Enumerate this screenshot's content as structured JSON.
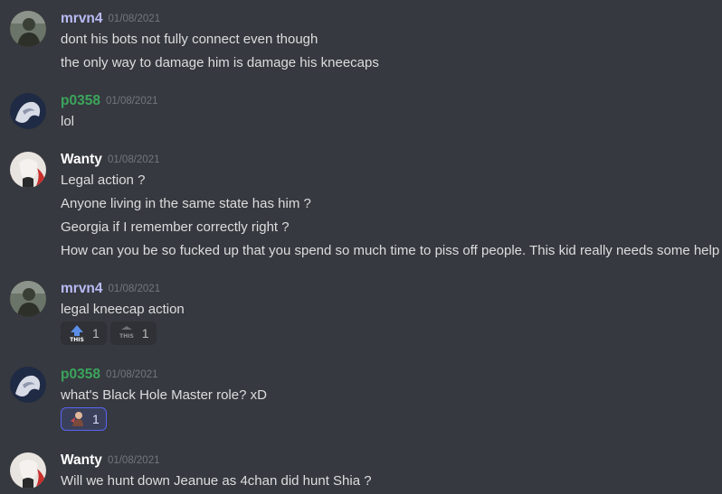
{
  "colors": {
    "background": "#36393f",
    "mrvn4": "#b9bbf5",
    "p0358": "#3ba55c",
    "wanty": "#ffffff",
    "timestamp": "#72767d",
    "text": "#dcddde",
    "reaction_me_border": "#5865f2"
  },
  "messages": [
    {
      "author": "mrvn4",
      "timestamp": "01/08/2021",
      "lines": [
        "dont his bots not fully connect even though",
        "the only way to damage him is damage his kneecaps"
      ]
    },
    {
      "author": "p0358",
      "timestamp": "01/08/2021",
      "lines": [
        "lol"
      ]
    },
    {
      "author": "Wanty",
      "timestamp": "01/08/2021",
      "lines": [
        "Legal action ?",
        "Anyone living in the same state has him ?",
        "Georgia if I remember correctly right ?",
        "How can you be so fucked up that you spend so much time to piss off people. This kid really needs some help"
      ]
    },
    {
      "author": "mrvn4",
      "timestamp": "01/08/2021",
      "lines": [
        "legal kneecap action"
      ],
      "reactions": [
        {
          "emoji": "this-up-arrow-emoji",
          "count": "1",
          "me": false
        },
        {
          "emoji": "this-emoji",
          "count": "1",
          "me": false
        }
      ]
    },
    {
      "author": "p0358",
      "timestamp": "01/08/2021",
      "lines": [
        "what's Black Hole Master role? xD"
      ],
      "reactions": [
        {
          "emoji": "custom-figure-emoji",
          "count": "1",
          "me": true
        }
      ]
    },
    {
      "author": "Wanty",
      "timestamp": "01/08/2021",
      "lines": [
        "Will we hunt down Jeanue as 4chan did hunt Shia ?"
      ]
    }
  ]
}
